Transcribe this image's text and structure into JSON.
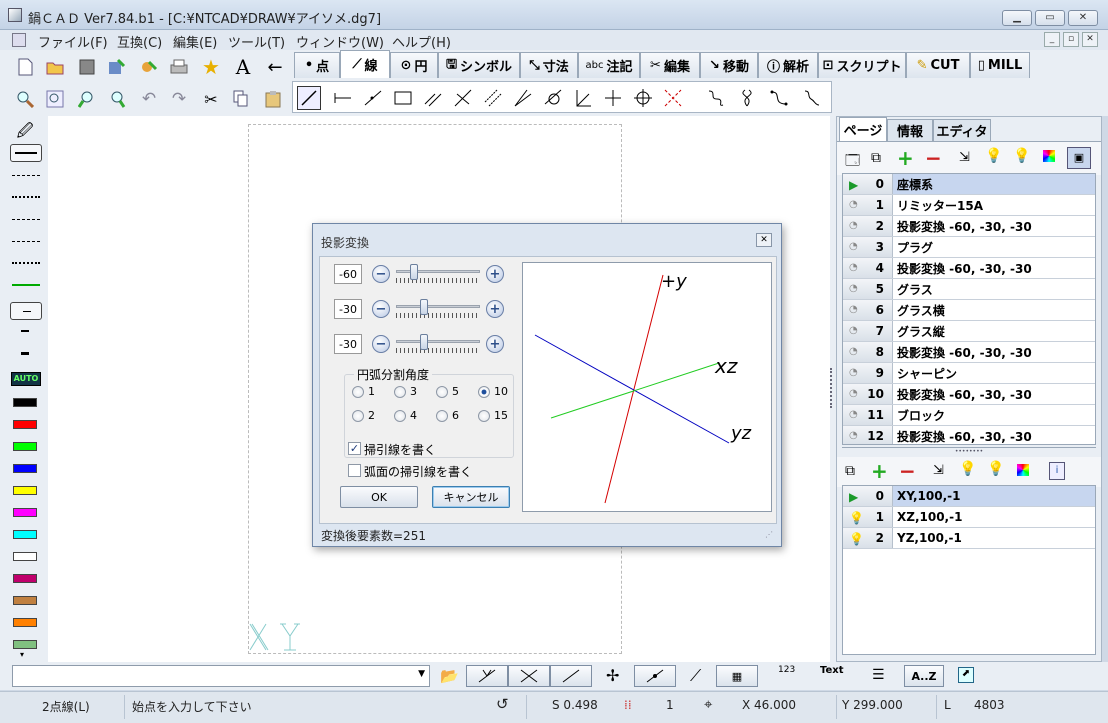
{
  "window": {
    "title": "鍋ＣＡＤ Ver7.84.b1 - [C:¥NTCAD¥DRAW¥アイソメ.dg7]"
  },
  "menu": [
    "ファイル(F)",
    "互換(C)",
    "編集(E)",
    "ツール(T)",
    "ウィンドウ(W)",
    "ヘルプ(H)"
  ],
  "mode_tabs": [
    "点",
    "線",
    "円",
    "シンボル",
    "寸法",
    "注記",
    "編集",
    "移動",
    "解析",
    "スクリプト",
    "CUT",
    "MILL"
  ],
  "mode_tab_prefix": {
    "annotation": "abc"
  },
  "active_mode_tab": "線",
  "dialog": {
    "title": "投影変換",
    "values": [
      "-60",
      "-30",
      "-30"
    ],
    "slider_levels": [
      0.22,
      0.33,
      0.33
    ],
    "arc_group_label": "円弧分割角度",
    "arc_options": [
      "1",
      "3",
      "5",
      "10",
      "2",
      "4",
      "6",
      "15"
    ],
    "arc_selected": "10",
    "checkbox1": {
      "label": "掃引線を書く",
      "checked": true
    },
    "checkbox2": {
      "label": "弧面の掃引線を書く",
      "checked": false
    },
    "ok": "OK",
    "cancel": "キャンセル",
    "status": "変換後要素数=251",
    "axis_labels": {
      "top": "+y",
      "right": "xz",
      "bottom": "yz"
    }
  },
  "side_tabs": [
    "ページ",
    "情報",
    "エディタ"
  ],
  "pages": [
    {
      "num": "0",
      "name": "座標系",
      "active": true
    },
    {
      "num": "1",
      "name": "リミッター15A"
    },
    {
      "num": "2",
      "name": "投影変換 -60, -30, -30"
    },
    {
      "num": "3",
      "name": "プラグ"
    },
    {
      "num": "4",
      "name": "投影変換 -60, -30, -30"
    },
    {
      "num": "5",
      "name": "グラス"
    },
    {
      "num": "6",
      "name": "グラス横"
    },
    {
      "num": "7",
      "name": "グラス縦"
    },
    {
      "num": "8",
      "name": "投影変換 -60, -30, -30"
    },
    {
      "num": "9",
      "name": "シャーピン"
    },
    {
      "num": "10",
      "name": "投影変換 -60, -30, -30"
    },
    {
      "num": "11",
      "name": "ブロック"
    },
    {
      "num": "12",
      "name": "投影変換 -60, -30, -30"
    }
  ],
  "layers": [
    {
      "num": "0",
      "name": "XY,100,-1",
      "active": true
    },
    {
      "num": "1",
      "name": "XZ,100,-1"
    },
    {
      "num": "2",
      "name": "YZ,100,-1"
    }
  ],
  "bottom": {
    "text_btn": "Text",
    "az_btn": "A..Z",
    "num_btn": "123"
  },
  "auto_label": "AUTO",
  "status": {
    "mode": "2点線(L)",
    "prompt": "始点を入力して下さい",
    "scale": "S 0.498",
    "count": "1",
    "x": "X 46.000",
    "y": "Y 299.000",
    "l_label": "L",
    "l_value": "4803"
  },
  "colors": {
    "swatches": [
      "#000000",
      "#ff0000",
      "#00ff00",
      "#0000ff",
      "#ffff00",
      "#ff00ff",
      "#00ffff",
      "#ffffff",
      "#c0006c",
      "#c08040",
      "#ff8000",
      "#80c080"
    ]
  }
}
